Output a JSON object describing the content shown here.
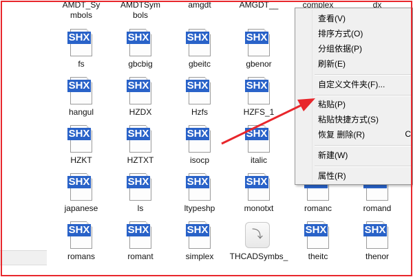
{
  "top_labels": [
    "AMDT_Sy",
    "AMDTSym",
    "amgdt",
    "AMGDT__",
    "complex",
    "dx"
  ],
  "rows": [
    [
      {
        "name": "fs",
        "icon": "shx"
      },
      {
        "name": "gbcbig",
        "icon": "shx"
      },
      {
        "name": "gbeitc",
        "icon": "shx"
      },
      {
        "name": "gbenor",
        "icon": "shx"
      }
    ],
    [
      {
        "name": "hangul",
        "icon": "shx"
      },
      {
        "name": "HZDX",
        "icon": "shx"
      },
      {
        "name": "Hzfs",
        "icon": "shx"
      },
      {
        "name": "HZFS_1",
        "icon": "shx"
      }
    ],
    [
      {
        "name": "HZKT",
        "icon": "shx"
      },
      {
        "name": "HZTXT",
        "icon": "shx"
      },
      {
        "name": "isocp",
        "icon": "shx"
      },
      {
        "name": "italic",
        "icon": "shx"
      }
    ],
    [
      {
        "name": "japanese",
        "icon": "shx"
      },
      {
        "name": "ls",
        "icon": "shx"
      },
      {
        "name": "ltypeshp",
        "icon": "shx"
      },
      {
        "name": "monotxt",
        "icon": "shx"
      },
      {
        "name": "romanc",
        "icon": "shx"
      },
      {
        "name": "romand",
        "icon": "shx"
      }
    ],
    [
      {
        "name": "romans",
        "icon": "shx"
      },
      {
        "name": "romant",
        "icon": "shx"
      },
      {
        "name": "simplex",
        "icon": "shx"
      },
      {
        "name": "THCADSymbs_",
        "icon": "generic"
      },
      {
        "name": "theitc",
        "icon": "shx"
      },
      {
        "name": "thenor",
        "icon": "shx"
      }
    ]
  ],
  "row1_second_lines": [
    "mbols",
    "bols"
  ],
  "shx_badge": "SHX",
  "generic_glyph": "⤵",
  "context_menu": {
    "items": [
      {
        "key": "view",
        "label": "查看(V)"
      },
      {
        "key": "sort",
        "label": "排序方式(O)"
      },
      {
        "key": "group",
        "label": "分组依据(P)"
      },
      {
        "key": "refresh",
        "label": "刷新(E)"
      },
      {
        "key": "customize",
        "label": "自定义文件夹(F)..."
      },
      {
        "key": "paste",
        "label": "粘贴(P)"
      },
      {
        "key": "paste-shortcut",
        "label": "粘贴快捷方式(S)"
      },
      {
        "key": "undo-delete",
        "label": "恢复 删除(R)"
      },
      {
        "key": "new",
        "label": "新建(W)"
      },
      {
        "key": "properties",
        "label": "属性(R)"
      }
    ],
    "undo_shortcut": "C"
  },
  "colors": {
    "frame": "#e8262b",
    "shx_badge": "#2962c8",
    "arrow": "#e8262b"
  }
}
